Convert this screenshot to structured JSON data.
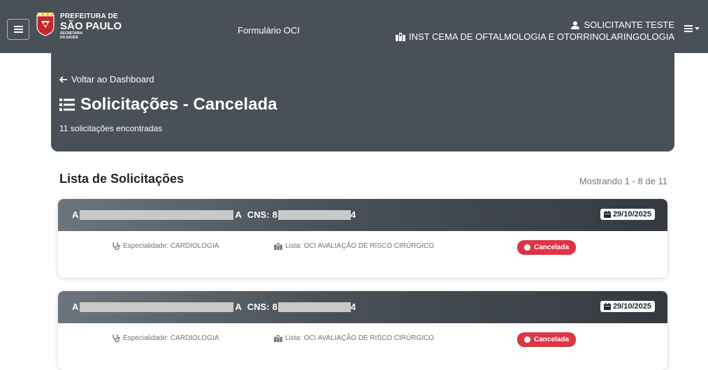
{
  "navbar": {
    "logo": {
      "line1": "PREFEITURA DE",
      "line2": "SÃO PAULO",
      "line3": "SECRETARIA",
      "line4": "DA SAÚDE"
    },
    "title": "Formulário OCI",
    "user": "SOLICITANTE TESTE",
    "institution": "INST CEMA DE OFTALMOLOGIA E OTORRINOLARINGOLOGIA"
  },
  "header": {
    "back_label": "Voltar ao Dashboard",
    "title": "Solicitações - Cancelada",
    "count": "11 solicitações encontradas"
  },
  "list": {
    "title": "Lista de Solicitações",
    "showing": "Mostrando 1 - 8 de 11"
  },
  "requests": [
    {
      "name_start": "A",
      "name_end": "A",
      "cns_label": "CNS:",
      "cns_start": "8",
      "cns_end": "4",
      "date": "29/10/2025",
      "specialty": "Especialidade: CARDIOLOGIA",
      "list": "Lista: OCI AVALIAÇÃO DE RISCO CIRÚRGICO",
      "status": "Cancelada"
    },
    {
      "name_start": "A",
      "name_end": "A",
      "cns_label": "CNS:",
      "cns_start": "8",
      "cns_end": "4",
      "date": "29/10/2025",
      "specialty": "Especialidade: CARDIOLOGIA",
      "list": "Lista: OCI AVALIAÇÃO DE RISCO CIRÚRGICO",
      "status": "Cancelada"
    }
  ],
  "icons": {
    "menu": "hamburger-icon",
    "user": "user-icon",
    "institution": "hospital-icon",
    "back": "arrow-left-icon",
    "list": "list-icon",
    "calendar": "calendar-icon",
    "stethoscope": "stethoscope-icon",
    "status": "circle-icon"
  },
  "colors": {
    "navbar": "#495057",
    "status_danger": "#dc3545"
  }
}
